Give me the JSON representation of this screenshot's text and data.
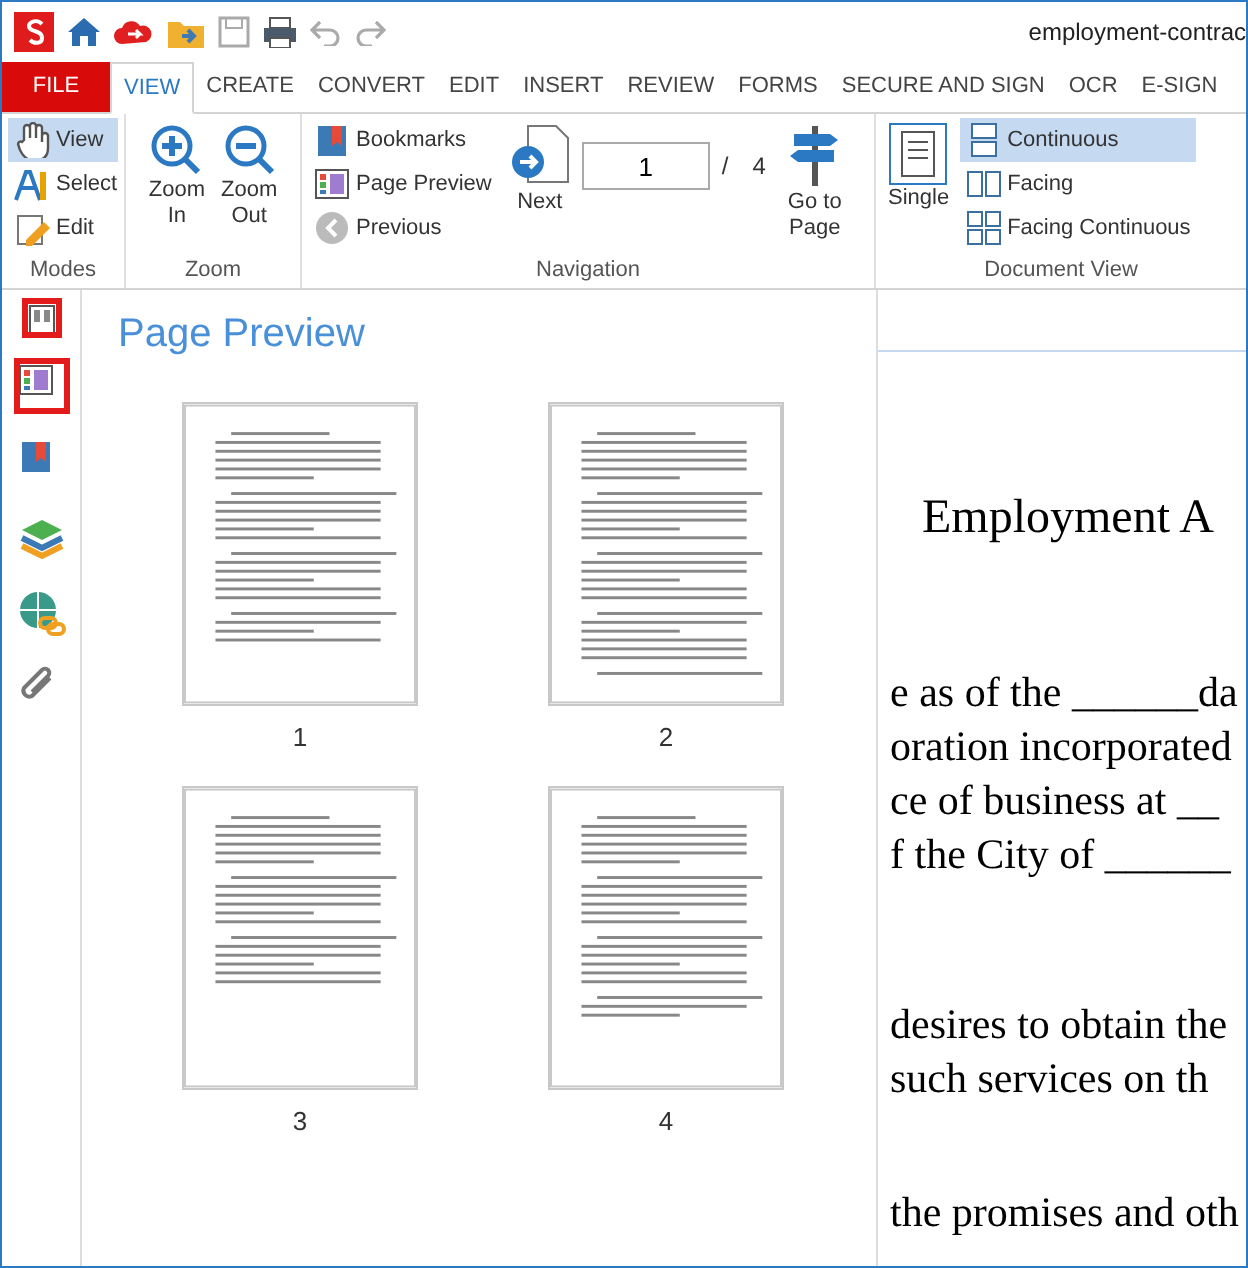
{
  "window": {
    "title": "employment-contrac"
  },
  "ribbon_tabs": [
    {
      "label": "FILE",
      "kind": "file",
      "selected": false
    },
    {
      "label": "VIEW",
      "kind": "tab",
      "selected": true
    },
    {
      "label": "CREATE",
      "kind": "tab",
      "selected": false
    },
    {
      "label": "CONVERT",
      "kind": "tab",
      "selected": false
    },
    {
      "label": "EDIT",
      "kind": "tab",
      "selected": false
    },
    {
      "label": "INSERT",
      "kind": "tab",
      "selected": false
    },
    {
      "label": "REVIEW",
      "kind": "tab",
      "selected": false
    },
    {
      "label": "FORMS",
      "kind": "tab",
      "selected": false
    },
    {
      "label": "SECURE AND SIGN",
      "kind": "tab",
      "selected": false
    },
    {
      "label": "OCR",
      "kind": "tab",
      "selected": false
    },
    {
      "label": "E-SIGN",
      "kind": "tab",
      "selected": false
    }
  ],
  "modes": {
    "label": "Modes",
    "items": [
      {
        "label": "View",
        "selected": true
      },
      {
        "label": "Select",
        "selected": false
      },
      {
        "label": "Edit",
        "selected": false
      }
    ]
  },
  "zoom": {
    "label": "Zoom",
    "buttons": [
      {
        "label": "Zoom\nIn"
      },
      {
        "label": "Zoom\nOut"
      }
    ]
  },
  "navigation": {
    "label": "Navigation",
    "links": [
      {
        "label": "Bookmarks"
      },
      {
        "label": "Page Preview"
      },
      {
        "label": "Previous"
      }
    ],
    "next": "Next",
    "page_value": "1",
    "separator": "/",
    "page_count": "4",
    "go_to": "Go to\nPage"
  },
  "document_view": {
    "label": "Document View",
    "single": "Single",
    "options": [
      {
        "label": "Continuous",
        "selected": true
      },
      {
        "label": "Facing",
        "selected": false
      },
      {
        "label": "Facing Continuous",
        "selected": false
      }
    ]
  },
  "side_tabs": [
    {
      "selected": true
    },
    {
      "selected": true
    },
    {
      "selected": false
    },
    {
      "selected": false
    },
    {
      "selected": false
    },
    {
      "selected": false
    }
  ],
  "panel": {
    "title": "Page Preview",
    "pages": [
      {
        "label": "1"
      },
      {
        "label": "2"
      },
      {
        "label": "3"
      },
      {
        "label": "4"
      }
    ]
  },
  "document": {
    "heading": "Employment A",
    "lines": [
      "e as of the ______da",
      "oration incorporated",
      "ce of business at __",
      "f the City of ______"
    ],
    "lines_2": [
      "desires to obtain the",
      "such services on th"
    ],
    "lines_3": [
      "the promises and oth"
    ]
  }
}
